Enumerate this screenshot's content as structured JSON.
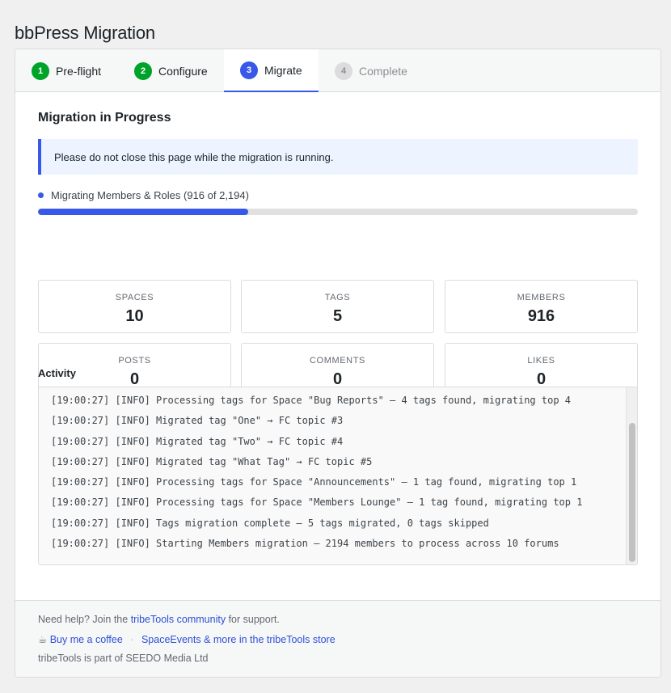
{
  "page": {
    "title": "bbPress Migration"
  },
  "tabs": [
    {
      "number": "1",
      "label": "Pre-flight",
      "state": "done"
    },
    {
      "number": "2",
      "label": "Configure",
      "state": "done"
    },
    {
      "number": "3",
      "label": "Migrate",
      "state": "active"
    },
    {
      "number": "4",
      "label": "Complete",
      "state": "pending"
    }
  ],
  "main": {
    "heading": "Migration in Progress",
    "notice": "Please do not close this page while the migration is running.",
    "progress": {
      "label": "Migrating Members & Roles (916 of 2,194)",
      "current": 916,
      "total": 2194,
      "percent": 35
    },
    "stats": [
      {
        "label": "SPACES",
        "value": "10"
      },
      {
        "label": "TAGS",
        "value": "5"
      },
      {
        "label": "MEMBERS",
        "value": "916"
      },
      {
        "label": "POSTS",
        "value": "0"
      },
      {
        "label": "COMMENTS",
        "value": "0"
      },
      {
        "label": "LIKES",
        "value": "0"
      }
    ],
    "activity_title": "Activity",
    "activity_lines": [
      "[19:00:27] [INFO] Processing tags for Space \"Bug Reports\" — 4 tags found, migrating top 4",
      "[19:00:27] [INFO] Migrated tag \"One\" → FC topic #3",
      "[19:00:27] [INFO] Migrated tag \"Two\" → FC topic #4",
      "[19:00:27] [INFO] Migrated tag \"What Tag\" → FC topic #5",
      "[19:00:27] [INFO] Processing tags for Space \"Announcements\" — 1 tag found, migrating top 1",
      "[19:00:27] [INFO] Processing tags for Space \"Members Lounge\" — 1 tag found, migrating top 1",
      "[19:00:27] [INFO] Tags migration complete — 5 tags migrated, 0 tags skipped",
      "[19:00:27] [INFO] Starting Members migration — 2194 members to process across 10 forums"
    ]
  },
  "footer": {
    "help_prefix": "Need help? Join the",
    "help_link": "tribeTools community",
    "help_suffix": "for support.",
    "coffee_icon": "☕",
    "coffee_link": "Buy me a coffee",
    "separator": "·",
    "store_link": "SpaceEvents & more in the tribeTools store",
    "company": "tribeTools is part of SEEDO Media Ltd"
  },
  "colors": {
    "accent": "#3858e9",
    "done": "#00a32a",
    "link": "#2c50d8"
  }
}
